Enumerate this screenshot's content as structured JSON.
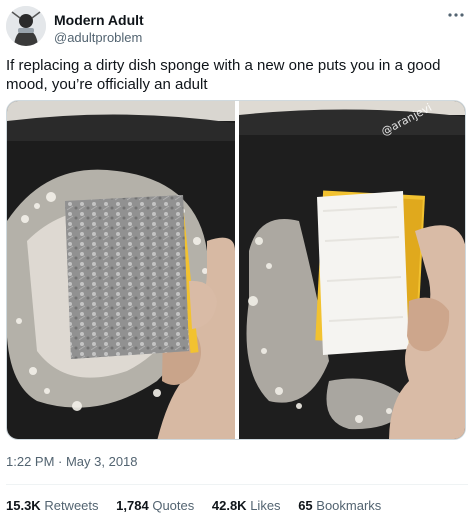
{
  "author": {
    "display_name": "Modern Adult",
    "handle": "@adultproblem",
    "avatar_icon": "profile-photo-icon"
  },
  "more_icon": "more-horizontal-icon",
  "tweet": {
    "text": "If replacing a dirty dish sponge with a new one puts you in a good mood, you’re officially an adult"
  },
  "media": {
    "left_image": "dirty-sponge-photo",
    "right_image": "new-sponge-photo",
    "watermark": "@aranjevi"
  },
  "timestamp": "1:22 PM · May 3, 2018",
  "stats": {
    "retweets_count": "15.3K",
    "retweets_label": "Retweets",
    "quotes_count": "1,784",
    "quotes_label": "Quotes",
    "likes_count": "42.8K",
    "likes_label": "Likes",
    "bookmarks_count": "65",
    "bookmarks_label": "Bookmarks"
  },
  "colors": {
    "text_primary": "#0f1419",
    "text_secondary": "#536471",
    "border": "#cfd9de",
    "sponge_yellow": "#f2c230"
  }
}
